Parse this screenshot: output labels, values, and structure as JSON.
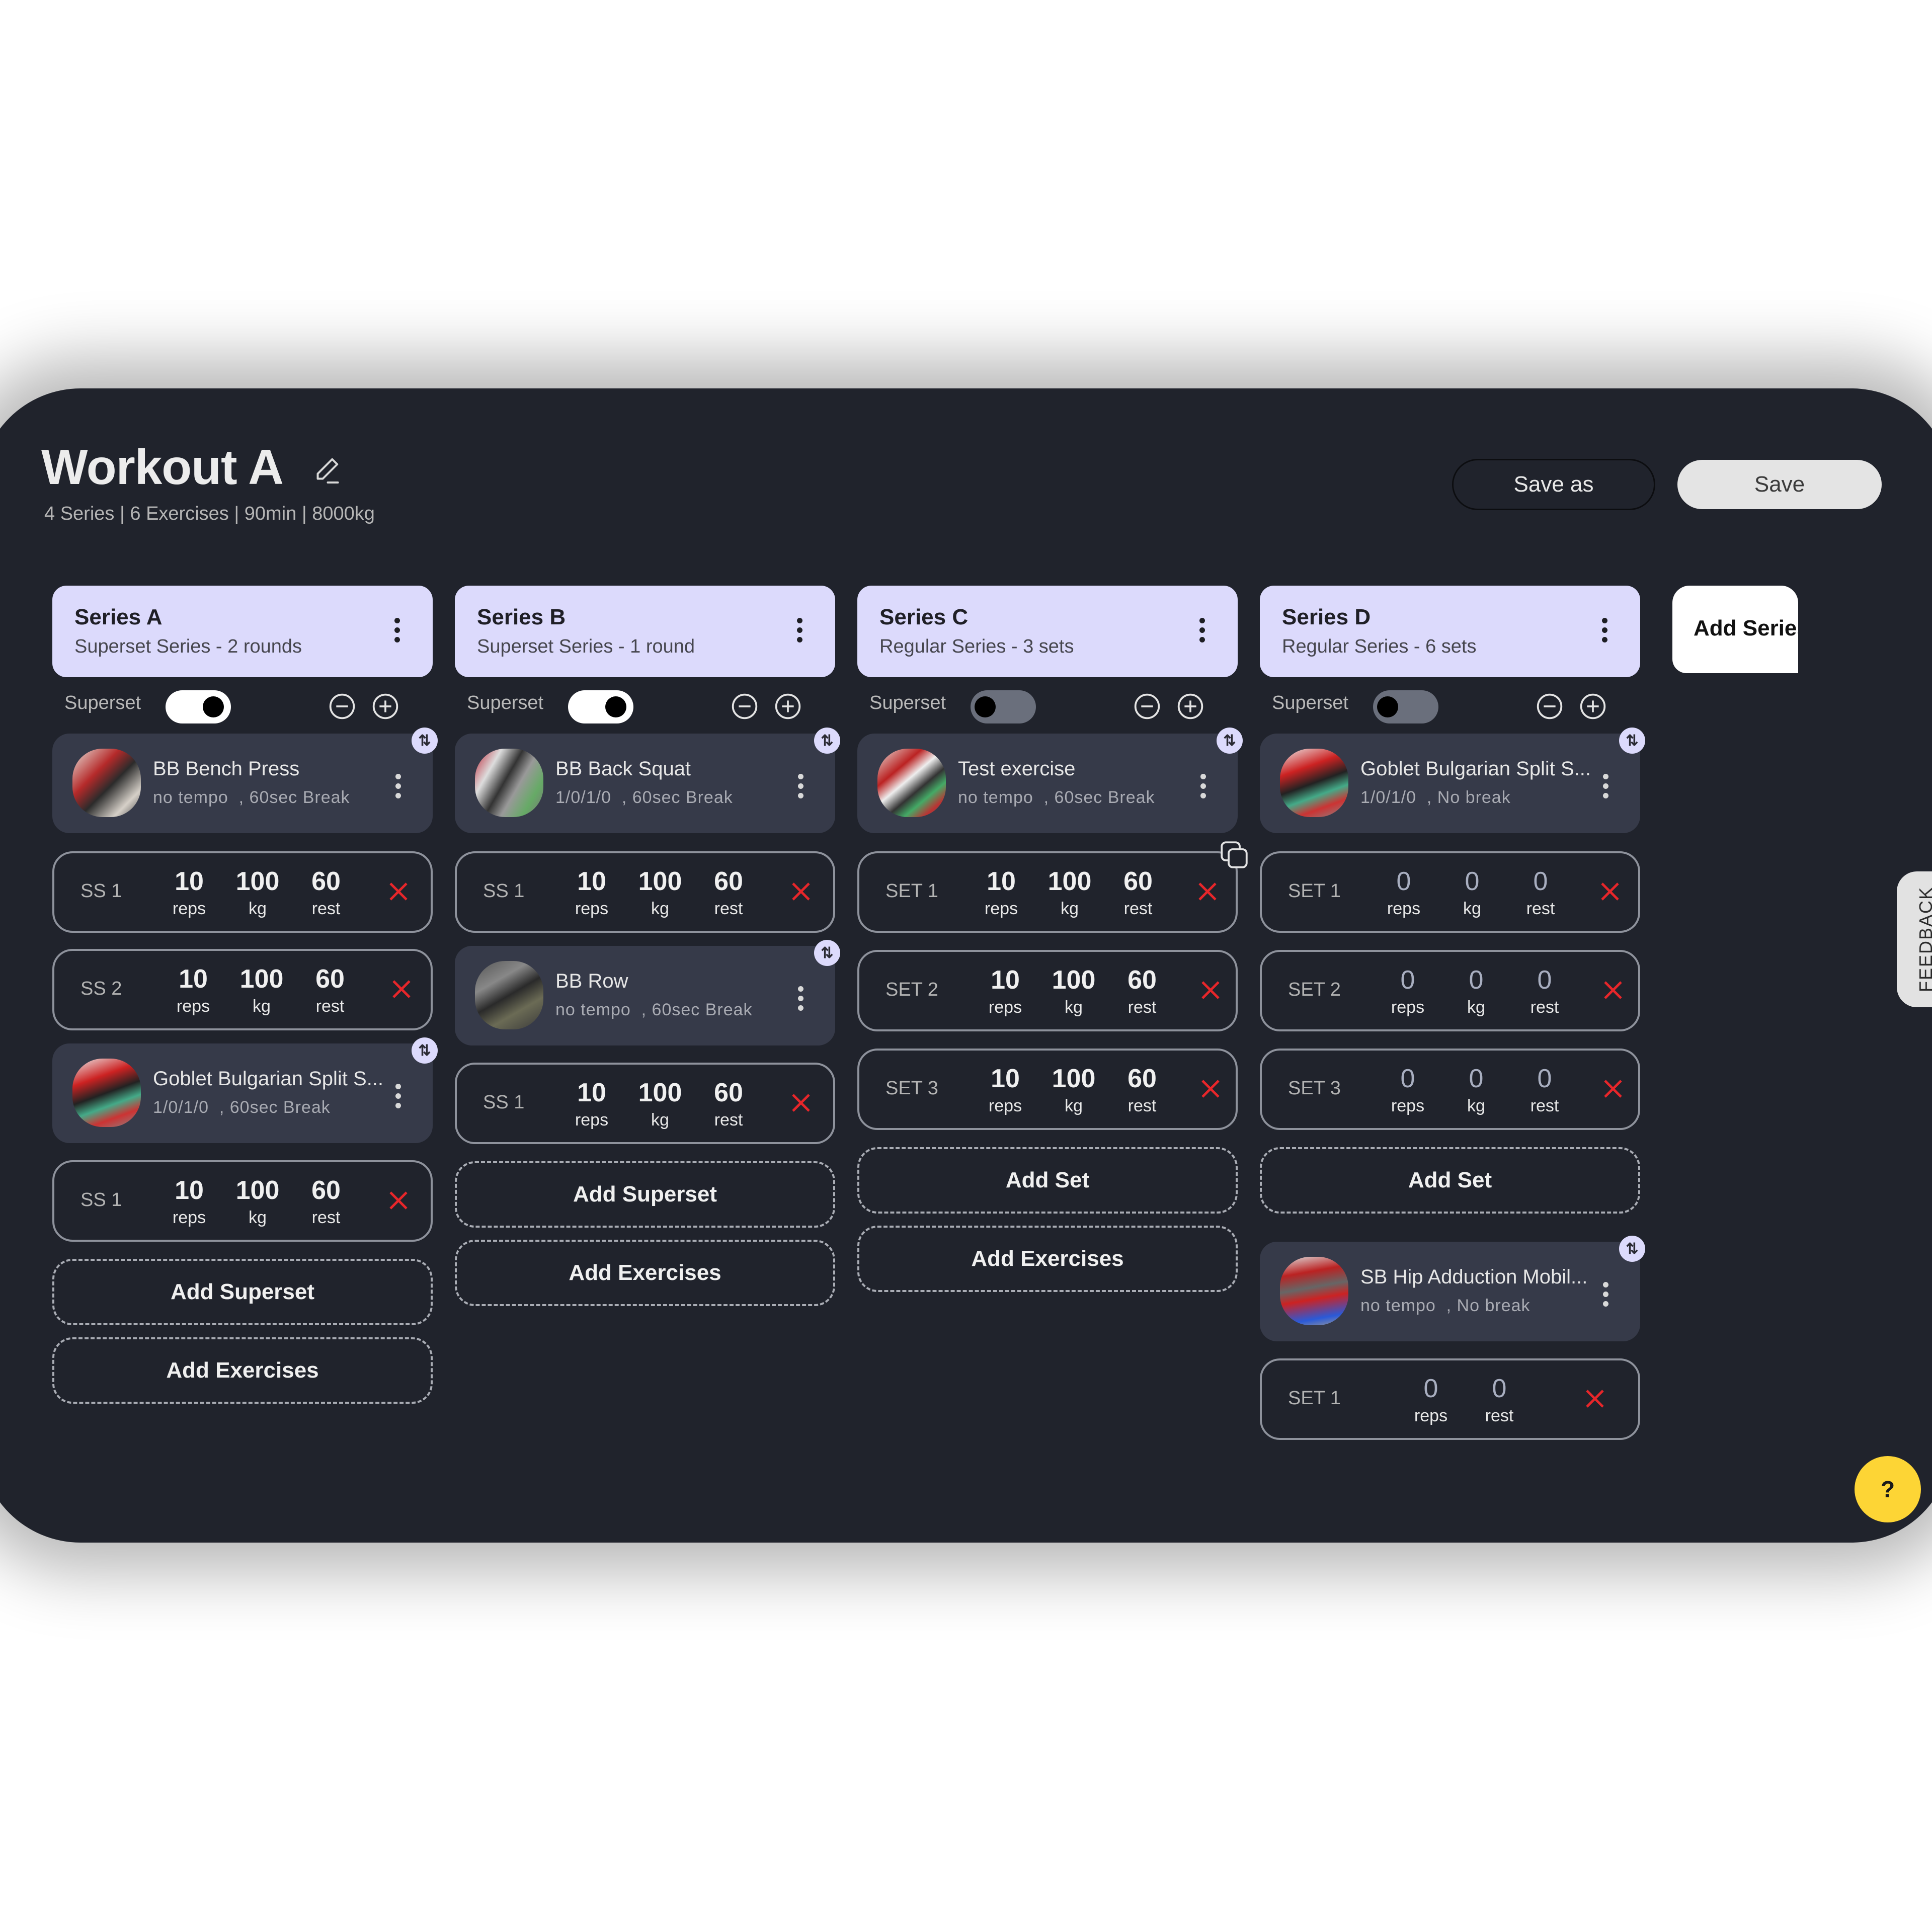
{
  "workout": {
    "title": "Workout A",
    "summary": "4 Series | 6 Exercises | 90min | 8000kg"
  },
  "header": {
    "save_as_label": "Save as",
    "save_label": "Save"
  },
  "add_series_label": "Add Series",
  "feedback_label": "FEEDBACK",
  "help_label": "?",
  "superset_label": "Superset",
  "labels": {
    "reps": "reps",
    "kg": "kg",
    "rest": "rest",
    "add_superset": "Add Superset",
    "add_exercises": "Add Exercises",
    "add_set": "Add Set"
  },
  "colors": {
    "panel_bg": "#20232c",
    "series_header": "#dcdafc",
    "exercise_card": "#363a49",
    "delete_red": "#e8262a",
    "help_yellow": "#fdd535"
  },
  "series": [
    {
      "name": "Series A",
      "type": "Superset Series - 2 rounds",
      "superset": true,
      "exercises": [
        {
          "name": "BB Bench Press",
          "meta": "no tempo  , 60sec Break",
          "sets": [
            {
              "label": "SS 1",
              "reps": "10",
              "kg": "100",
              "rest": "60"
            },
            {
              "label": "SS 2",
              "reps": "10",
              "kg": "100",
              "rest": "60"
            }
          ]
        },
        {
          "name": "Goblet Bulgarian Split S...",
          "meta": "1/0/1/0  , 60sec Break",
          "sets": [
            {
              "label": "SS 1",
              "reps": "10",
              "kg": "100",
              "rest": "60"
            }
          ]
        }
      ]
    },
    {
      "name": "Series B",
      "type": "Superset Series - 1 round",
      "superset": true,
      "exercises": [
        {
          "name": "BB Back Squat",
          "meta": "1/0/1/0  , 60sec Break",
          "sets": [
            {
              "label": "SS 1",
              "reps": "10",
              "kg": "100",
              "rest": "60"
            }
          ]
        },
        {
          "name": "BB Row",
          "meta": "no tempo  , 60sec Break",
          "sets": [
            {
              "label": "SS 1",
              "reps": "10",
              "kg": "100",
              "rest": "60"
            }
          ]
        }
      ]
    },
    {
      "name": "Series C",
      "type": "Regular Series - 3 sets",
      "superset": false,
      "exercises": [
        {
          "name": "Test exercise",
          "meta": "no tempo  , 60sec Break",
          "sets": [
            {
              "label": "SET 1",
              "reps": "10",
              "kg": "100",
              "rest": "60"
            },
            {
              "label": "SET 2",
              "reps": "10",
              "kg": "100",
              "rest": "60"
            },
            {
              "label": "SET 3",
              "reps": "10",
              "kg": "100",
              "rest": "60"
            }
          ]
        }
      ]
    },
    {
      "name": "Series D",
      "type": "Regular Series - 6 sets",
      "superset": false,
      "exercises": [
        {
          "name": "Goblet Bulgarian Split S...",
          "meta": "1/0/1/0  , No break",
          "sets": [
            {
              "label": "SET 1",
              "reps": "0",
              "kg": "0",
              "rest": "0"
            },
            {
              "label": "SET 2",
              "reps": "0",
              "kg": "0",
              "rest": "0"
            },
            {
              "label": "SET 3",
              "reps": "0",
              "kg": "0",
              "rest": "0"
            }
          ]
        },
        {
          "name": "SB Hip Adduction Mobil...",
          "meta": "no tempo  , No break",
          "sets": [
            {
              "label": "SET 1",
              "reps": "0",
              "rest": "0"
            }
          ]
        }
      ]
    }
  ]
}
